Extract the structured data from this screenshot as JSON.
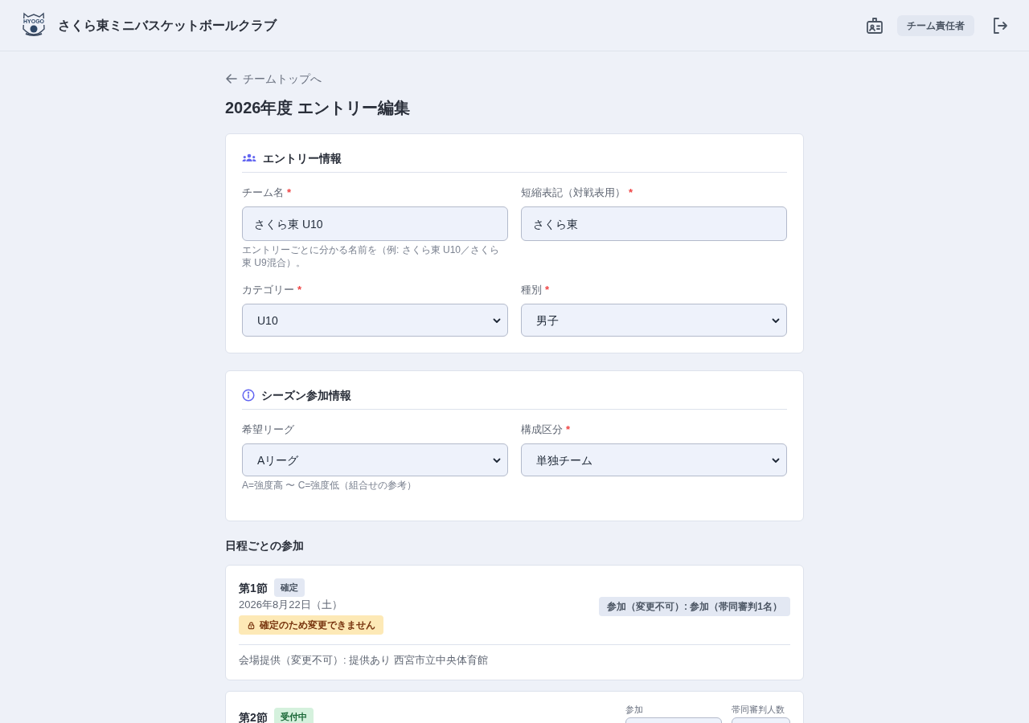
{
  "header": {
    "logo_text": "HYOGO",
    "title": "さくら東ミニバスケットボールクラブ",
    "role_badge": "チーム責任者"
  },
  "back_link": "チームトップへ",
  "page_title": "2026年度 エントリー編集",
  "sections": [
    {
      "kind": "entry",
      "title": "エントリー情報",
      "fields": [
        {
          "kind": "text",
          "label": "チーム名",
          "required_mark": "*",
          "value": "さくら東 U10",
          "help": "エントリーごとに分かる名前を（例: さくら東 U10／さくら東 U9混合）。"
        },
        {
          "kind": "text",
          "label": "短縮表記（対戦表用）",
          "required_mark": "*",
          "value": "さくら東"
        },
        {
          "kind": "select",
          "label": "カテゴリー",
          "required_mark": "*",
          "value": "U10"
        },
        {
          "kind": "select",
          "label": "種別",
          "required_mark": "*",
          "value": "男子"
        }
      ]
    },
    {
      "kind": "season",
      "title": "シーズン参加情報",
      "fields": [
        {
          "kind": "select",
          "label": "希望リーグ",
          "value": "Aリーグ",
          "help": "A=強度高 〜 C=強度低（組合せの参考）"
        },
        {
          "kind": "select",
          "label": "構成区分",
          "required_mark": "*",
          "value": "単独チーム"
        }
      ]
    }
  ],
  "schedule": {
    "title": "日程ごとの参加",
    "rounds": [
      {
        "kind": "confirmed",
        "name": "第1節",
        "status": "確定",
        "date": "2026年8月22日（土）",
        "lock_note": "確定のため変更できません",
        "participation": "参加（変更不可）: 参加（帯同審判1名）",
        "venue": "会場提供（変更不可）: 提供あり 西宮市立中央体育館"
      },
      {
        "kind": "open",
        "name": "第2節",
        "status": "受付中",
        "fields": [
          {
            "label": "参加"
          },
          {
            "label": "帯同審判人数"
          }
        ]
      }
    ]
  }
}
